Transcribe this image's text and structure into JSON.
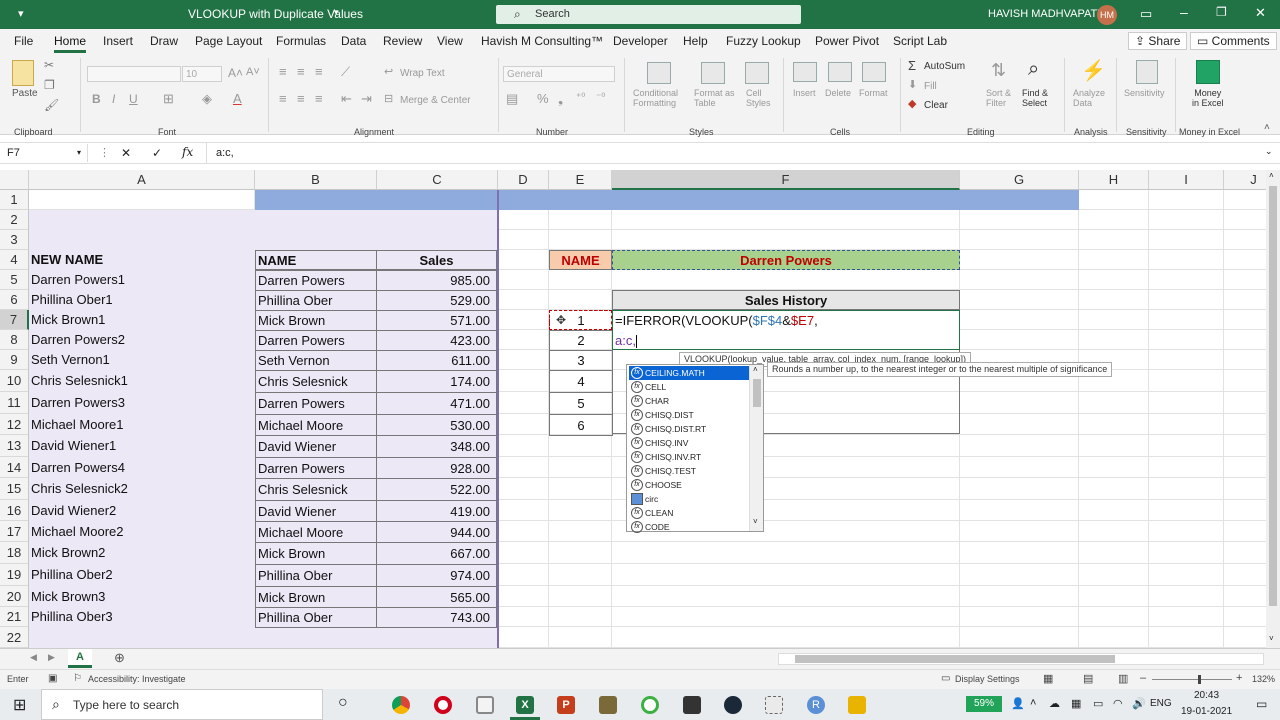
{
  "title_bar": {
    "doc_title": "VLOOKUP with Duplicate Values",
    "search_placeholder": "Search",
    "user_name": "HAVISH MADHVAPATY",
    "user_initials": "HM"
  },
  "tabs": [
    "File",
    "Home",
    "Insert",
    "Draw",
    "Page Layout",
    "Formulas",
    "Data",
    "Review",
    "View",
    "Havish M Consulting™",
    "Developer",
    "Help",
    "Fuzzy Lookup",
    "Power Pivot",
    "Script Lab"
  ],
  "share_label": "Share",
  "comments_label": "Comments",
  "ribbon": {
    "paste": "Paste",
    "font_size": "10",
    "number_format": "General",
    "wrap_text": "Wrap Text",
    "merge_center": "Merge & Center",
    "conditional": [
      "Conditional",
      "Formatting"
    ],
    "format_as_table": [
      "Format as",
      "Table"
    ],
    "cell_styles": [
      "Cell",
      "Styles"
    ],
    "insert": "Insert",
    "delete": "Delete",
    "format": "Format",
    "autosum": "AutoSum",
    "fill": "Fill",
    "clear": "Clear",
    "sort_filter": [
      "Sort &",
      "Filter"
    ],
    "find_select": [
      "Find &",
      "Select"
    ],
    "analyze": [
      "Analyze",
      "Data"
    ],
    "sensitivity": "Sensitivity",
    "money": [
      "Money",
      "in Excel"
    ],
    "groups": [
      "Clipboard",
      "Font",
      "Alignment",
      "Number",
      "Styles",
      "Cells",
      "Editing",
      "Analysis",
      "Sensitivity",
      "Money in Excel"
    ]
  },
  "formula_bar": {
    "name_box": "F7",
    "cancel": "✕",
    "enter": "✓",
    "fx": "fx",
    "content": "a:c,"
  },
  "columns": [
    "A",
    "B",
    "C",
    "D",
    "E",
    "F",
    "G",
    "H",
    "I",
    "J"
  ],
  "rows": [
    "1",
    "2",
    "3",
    "4",
    "5",
    "6",
    "7",
    "8",
    "9",
    "10",
    "11",
    "12",
    "13",
    "14",
    "15",
    "16",
    "17",
    "18",
    "19",
    "20",
    "21",
    "22"
  ],
  "sheet": {
    "a_header": "NEW NAME",
    "b_header": "NAME",
    "c_header": "Sales",
    "new_names": [
      "Darren Powers1",
      "Phillina Ober1",
      "Mick Brown1",
      "Darren Powers2",
      "Seth Vernon1",
      "Chris Selesnick1",
      "Darren Powers3",
      "Michael Moore1",
      "David Wiener1",
      "Darren Powers4",
      "Chris Selesnick2",
      "David Wiener2",
      "Michael Moore2",
      "Mick Brown2",
      "Phillina Ober2",
      "Mick Brown3",
      "Phillina Ober3"
    ],
    "names": [
      "Darren Powers",
      "Phillina Ober",
      "Mick Brown",
      "Darren Powers",
      "Seth Vernon",
      "Chris Selesnick",
      "Darren Powers",
      "Michael Moore",
      "David Wiener",
      "Darren Powers",
      "Chris Selesnick",
      "David Wiener",
      "Michael Moore",
      "Mick Brown",
      "Phillina Ober",
      "Mick Brown",
      "Phillina Ober"
    ],
    "sales": [
      "985.00",
      "529.00",
      "571.00",
      "423.00",
      "611.00",
      "174.00",
      "471.00",
      "530.00",
      "348.00",
      "928.00",
      "522.00",
      "419.00",
      "944.00",
      "667.00",
      "974.00",
      "565.00",
      "743.00"
    ],
    "lookup_label": "NAME",
    "lookup_value": "Darren Powers",
    "history_header": "Sales History",
    "history_index": [
      "1",
      "2",
      "3",
      "4",
      "5",
      "6"
    ],
    "formula_line1_a": "=IFERROR(VLOOKUP(",
    "formula_line1_b": "$F$4",
    "formula_line1_c": "&",
    "formula_line1_d": "$E7",
    "formula_line1_e": ",",
    "formula_line2": "a:c,"
  },
  "tooltip_syntax": "VLOOKUP(lookup_value, table_array, col_index_num, [range_lookup])",
  "tooltip_desc": "Rounds a number up, to the nearest integer or to the nearest multiple of significance",
  "autocomplete": [
    "CEILING.MATH",
    "CELL",
    "CHAR",
    "CHISQ.DIST",
    "CHISQ.DIST.RT",
    "CHISQ.INV",
    "CHISQ.INV.RT",
    "CHISQ.TEST",
    "CHOOSE",
    "circ",
    "CLEAN",
    "CODE"
  ],
  "status": {
    "mode": "Enter",
    "accessibility": "Accessibility: Investigate",
    "display_settings": "Display Settings",
    "zoom": "132%"
  },
  "sheet_tab": "A",
  "taskbar": {
    "search": "Type here to search",
    "battery": "59%",
    "lang": "ENG",
    "time": "20:43",
    "date": "19-01-2021"
  },
  "colors": {
    "excel_green": "#217346",
    "selection": "#0a64d4",
    "header_blue": "#8faadc",
    "lavender": "#ece8f6",
    "green_fill": "#a9d18e"
  }
}
